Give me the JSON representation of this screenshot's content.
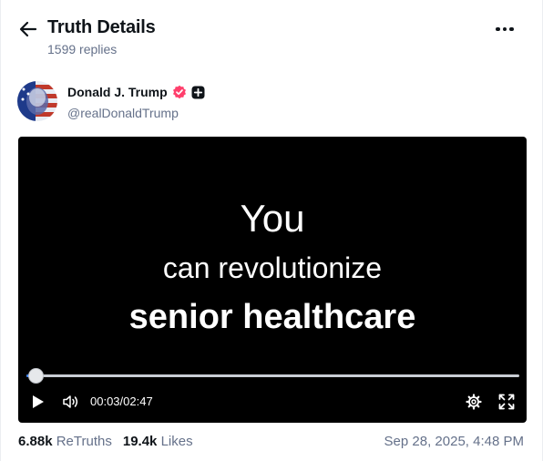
{
  "header": {
    "title": "Truth Details",
    "replies": "1599 replies"
  },
  "author": {
    "name": "Donald J. Trump",
    "handle": "@realDonaldTrump",
    "verified_color": "#ff3f6c",
    "icons": [
      "back-arrow-icon",
      "more-icon",
      "verified-badge-icon",
      "plus-badge-icon"
    ]
  },
  "video": {
    "caption_line1": "You",
    "caption_line2": "can revolutionize",
    "caption_line3": "senior healthcare",
    "current_time": "00:03",
    "duration": "02:47",
    "progress": 0.018,
    "accent_color": "#3b82f6"
  },
  "stats": {
    "retruths_count": "6.88k",
    "retruths_label": "ReTruths",
    "likes_count": "19.4k",
    "likes_label": "Likes",
    "date": "Sep 28, 2025, 4:48 PM"
  }
}
